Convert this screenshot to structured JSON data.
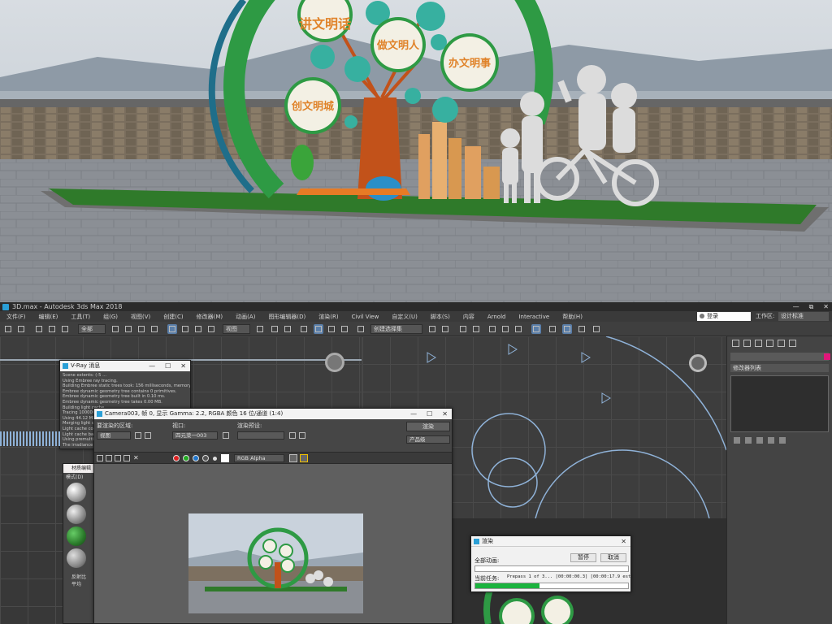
{
  "scene": {
    "sign_circle_1": "讲文明话",
    "sign_circle_2": "做文明人",
    "sign_circle_3": "办文明事",
    "sign_circle_4": "创文明城"
  },
  "app": {
    "title": "3D.max - Autodesk 3ds Max 2018",
    "window_controls": [
      "—",
      "⧉",
      "✕"
    ],
    "menu": [
      "文件(F)",
      "编辑(E)",
      "工具(T)",
      "组(G)",
      "视图(V)",
      "创建(C)",
      "修改器(M)",
      "动画(A)",
      "图形编辑器(D)",
      "渲染(R)",
      "Civil View",
      "自定义(U)",
      "脚本(S)",
      "内容",
      "Arnold",
      "Interactive",
      "帮助(H)"
    ],
    "login": "登录",
    "workspace_label": "工作区:",
    "workspace_value": "设计标准"
  },
  "toolbar": {
    "selection_filter": "全部",
    "reference_coord": "视图",
    "named_selection": "创建选择集"
  },
  "command_panel": {
    "modifier_list": "修改器列表"
  },
  "vray_log": {
    "title": "V-Ray 消息",
    "lines": [
      "Scene extents: (-5 ...",
      "Using Embree ray tracing.",
      "Building Embree static trees took: 156 milliseconds, memory u...",
      "Embree dynamic geometry tree contains 0 primitives.",
      "Embree dynamic geometry tree built in 0.10 ms.",
      "Embree dynamic geometry tree takes 0.00 MB.",
      "Building light cache...",
      "Tracing 100000...",
      "Using 44.12 MB...",
      "Merging light cac...",
      "Light cache conta...",
      "Light cache bas...",
      "Using premultip...",
      "The irradiance m..."
    ]
  },
  "frame_buffer": {
    "title": "Camera003, 帧 0, 显示 Gamma: 2.2, RGBA 颜色 16 位/通道 (1:4)",
    "area_label": "要渲染的区域:",
    "area_value": "视图",
    "viewport_label": "视口:",
    "viewport_value": "四元菜一003",
    "preset_label": "渲染预设:",
    "preset_value": "",
    "render_button": "渲染",
    "product_level": "产品级",
    "channel": "RGB Alpha"
  },
  "material_editor": {
    "title": "材质编辑",
    "menu": "模式(D)",
    "label1": "反射比",
    "label2": "平均"
  },
  "render_progress": {
    "title": "渲染",
    "all_animation": "全部动画:",
    "stop_button": "暂停",
    "cancel_button": "取消",
    "current_task_label": "当前任务:",
    "current_task_text": "Prepass 1 of 3... [00:00:00.3] [00:00:17.9 est]",
    "all_progress": 0.0,
    "current_progress": 0.42
  },
  "colors": {
    "progress_green": "#1bb33e",
    "sign_green": "#2e9a44",
    "sign_orange": "#e0832a"
  }
}
